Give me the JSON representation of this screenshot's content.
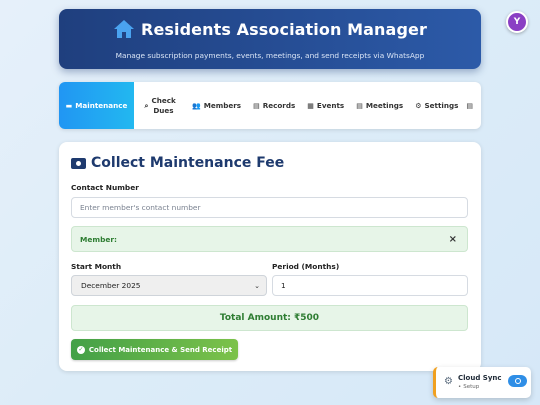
{
  "header": {
    "title": "Residents Association Manager",
    "subtitle": "Manage subscription payments, events, meetings, and send receipts via WhatsApp",
    "icon": "home-icon"
  },
  "logo_badge": {
    "text": "Y",
    "color": "#8a3fc4"
  },
  "nav": {
    "items": [
      {
        "label": "Maintenance",
        "icon": "money-icon",
        "active": true
      },
      {
        "label": "Check Dues",
        "icon": "search-icon"
      },
      {
        "label": "Members",
        "icon": "users-icon"
      },
      {
        "label": "Records",
        "icon": "document-icon"
      },
      {
        "label": "Events",
        "icon": "calendar-icon"
      },
      {
        "label": "Meetings",
        "icon": "notes-icon"
      },
      {
        "label": "Settings",
        "icon": "gear-icon"
      }
    ]
  },
  "form": {
    "title": "Collect Maintenance Fee",
    "contact_label": "Contact Number",
    "contact_placeholder": "Enter member's contact number",
    "member_label": "Member:",
    "close_symbol": "×",
    "start_month_label": "Start Month",
    "start_month_value": "December 2025",
    "period_label": "Period (Months)",
    "period_value": "1",
    "total_label": "Total Amount: ₹500",
    "submit_label": "Collect Maintenance & Send Receipt"
  },
  "cloud_sync": {
    "title": "Cloud Sync",
    "subtitle": "Setup"
  },
  "colors": {
    "accent": "#2196f3",
    "header": "#1f3f7e",
    "success": "#2e7d32",
    "warning": "#f0a020"
  }
}
